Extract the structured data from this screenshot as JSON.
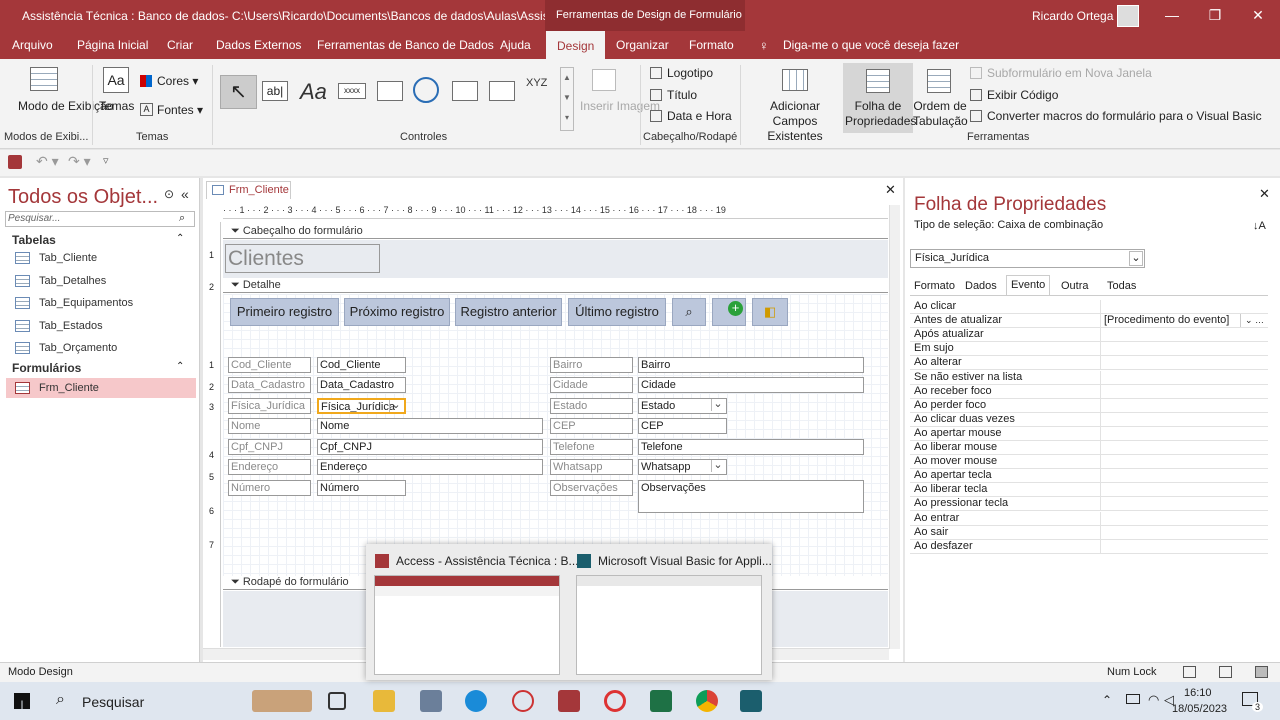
{
  "window": {
    "title": "Assistência Técnica : Banco de dados- C:\\Users\\Ricardo\\Documents\\Bancos de dados\\Aulas\\Assistên...",
    "context_tool": "Ferramentas de Design de Formulário",
    "user": "Ricardo Ortega",
    "controls": {
      "minimize": "—",
      "restore": "❐",
      "close": "✕"
    }
  },
  "ribbon_tabs": [
    "Arquivo",
    "Página Inicial",
    "Criar",
    "Dados Externos",
    "Ferramentas de Banco de Dados",
    "Ajuda",
    "Design",
    "Organizar",
    "Formato"
  ],
  "active_tab": "Design",
  "tell_me": "Diga-me o que você deseja fazer",
  "ribbon": {
    "modo_exibicao": "Modo de Exibição",
    "temas": "Temas",
    "cores": "Cores",
    "fontes": "Fontes",
    "inserir_imagem": "Inserir Imagem",
    "logotipo": "Logotipo",
    "titulo": "Título",
    "data_hora": "Data e Hora",
    "adicionar_campos": "Adicionar Campos Existentes",
    "folha_propriedades": "Folha de Propriedades",
    "ordem_tabulacao": "Ordem de Tabulação",
    "subformulario": "Subformulário em Nova Janela",
    "exibir_codigo": "Exibir Código",
    "converter_macros": "Converter macros do formulário para o Visual Basic",
    "groups": {
      "modos": "Modos de Exibi...",
      "temas": "Temas",
      "controles": "Controles",
      "cabecalho": "Cabeçalho/Rodapé",
      "ferramentas": "Ferramentas"
    }
  },
  "nav": {
    "title": "Todos os Objet...",
    "search_placeholder": "Pesquisar...",
    "tables_label": "Tabelas",
    "tables": [
      "Tab_Cliente",
      "Tab_Detalhes",
      "Tab_Equipamentos",
      "Tab_Estados",
      "Tab_Orçamento"
    ],
    "forms_label": "Formulários",
    "forms": [
      "Frm_Cliente"
    ]
  },
  "document": {
    "tab": "Frm_Cliente",
    "ruler": "· · · 1 · · · 2 · · · 3 · · · 4 · · · 5 · · · 6 · · · 7 · · · 8 · · · 9 · · · 10 · · · 11 · · · 12 · · · 13 · · · 14 · · · 15 · · · 16 · · · 17 · · · 18 · · · 19",
    "vruler": [
      "1",
      "2",
      "1",
      "2",
      "3",
      "4",
      "5",
      "6",
      "7"
    ],
    "header_section": "Cabeçalho do formulário",
    "form_title": "Clientes",
    "detail_section": "Detalhe",
    "footer_section": "Rodapé do formulário",
    "buttons": [
      "Primeiro registro",
      "Próximo registro",
      "Registro anterior",
      "Último registro"
    ],
    "left_fields": [
      {
        "label": "Cod_Cliente",
        "value": "Cod_Cliente"
      },
      {
        "label": "Data_Cadastro",
        "value": "Data_Cadastro"
      },
      {
        "label": "Física_Jurídica",
        "value": "Física_Jurídica"
      },
      {
        "label": "Nome",
        "value": "Nome"
      },
      {
        "label": "Cpf_CNPJ",
        "value": "Cpf_CNPJ"
      },
      {
        "label": "Endereço",
        "value": "Endereço"
      },
      {
        "label": "Número",
        "value": "Número"
      }
    ],
    "right_fields": [
      {
        "label": "Bairro",
        "value": "Bairro"
      },
      {
        "label": "Cidade",
        "value": "Cidade"
      },
      {
        "label": "Estado",
        "value": "Estado"
      },
      {
        "label": "CEP",
        "value": "CEP"
      },
      {
        "label": "Telefone",
        "value": "Telefone"
      },
      {
        "label": "Whatsapp",
        "value": "Whatsapp"
      },
      {
        "label": "Observações",
        "value": "Observações"
      }
    ]
  },
  "properties": {
    "title": "Folha de Propriedades",
    "selection_type": "Tipo de seleção:  Caixa de combinação",
    "selected": "Física_Jurídica",
    "tabs": [
      "Formato",
      "Dados",
      "Evento",
      "Outra",
      "Todas"
    ],
    "active_tab": "Evento",
    "rows": [
      {
        "name": "Ao clicar",
        "value": ""
      },
      {
        "name": "Antes de atualizar",
        "value": "[Procedimento do evento]"
      },
      {
        "name": "Após atualizar",
        "value": ""
      },
      {
        "name": "Em sujo",
        "value": ""
      },
      {
        "name": "Ao alterar",
        "value": ""
      },
      {
        "name": "Se não estiver na lista",
        "value": ""
      },
      {
        "name": "Ao receber foco",
        "value": ""
      },
      {
        "name": "Ao perder foco",
        "value": ""
      },
      {
        "name": "Ao clicar duas vezes",
        "value": ""
      },
      {
        "name": "Ao apertar mouse",
        "value": ""
      },
      {
        "name": "Ao liberar mouse",
        "value": ""
      },
      {
        "name": "Ao mover mouse",
        "value": ""
      },
      {
        "name": "Ao apertar tecla",
        "value": ""
      },
      {
        "name": "Ao liberar tecla",
        "value": ""
      },
      {
        "name": "Ao pressionar tecla",
        "value": ""
      },
      {
        "name": "Ao entrar",
        "value": ""
      },
      {
        "name": "Ao sair",
        "value": ""
      },
      {
        "name": "Ao desfazer",
        "value": ""
      }
    ]
  },
  "status": {
    "mode": "Modo Design",
    "numlock": "Num Lock"
  },
  "taskbar": {
    "search": "Pesquisar",
    "time": "16:10",
    "date": "18/05/2023",
    "notifications": "3",
    "preview": [
      {
        "title": "Access - Assistência Técnica : B..."
      },
      {
        "title": "Microsoft Visual Basic for Appli..."
      }
    ]
  },
  "colors": {
    "accent": "#a4373a",
    "button": "#bcc7dc",
    "selection": "#f6c8ca"
  }
}
